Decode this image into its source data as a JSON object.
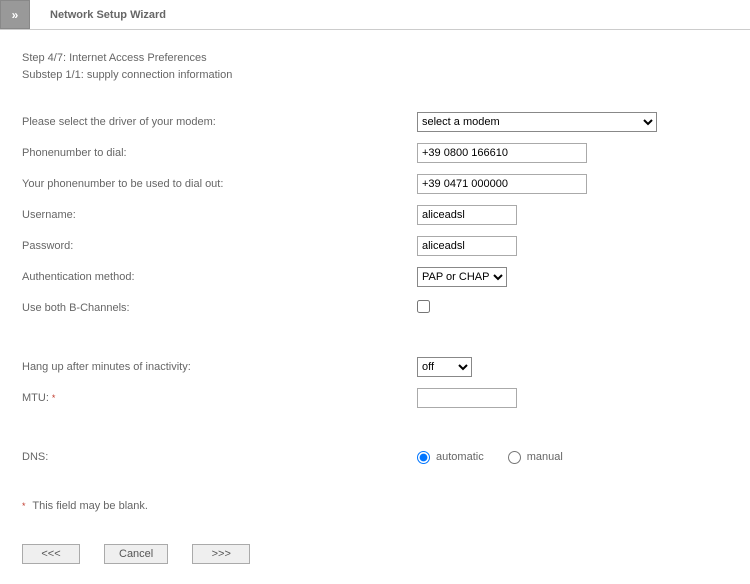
{
  "header": {
    "arrow": "»",
    "title": "Network Setup Wizard"
  },
  "step": {
    "line1": "Step 4/7: Internet Access Preferences",
    "line2": "Substep 1/1: supply connection information"
  },
  "fields": {
    "modem_label": "Please select the driver of your modem:",
    "modem_selected": "select a modem",
    "phone_dial_label": "Phonenumber to dial:",
    "phone_dial_value": "+39 0800 166610",
    "phone_out_label": "Your phonenumber to be used to dial out:",
    "phone_out_value": "+39 0471 000000",
    "username_label": "Username:",
    "username_value": "aliceadsl",
    "password_label": "Password:",
    "password_value": "aliceadsl",
    "auth_label": "Authentication method:",
    "auth_selected": "PAP or CHAP",
    "bchannels_label": "Use both B-Channels:",
    "hangup_label": "Hang up after minutes of inactivity:",
    "hangup_selected": "off",
    "mtu_label": "MTU:",
    "mtu_value": "",
    "dns_label": "DNS:",
    "dns_auto": "automatic",
    "dns_manual": "manual"
  },
  "marker": "*",
  "footnote": " This field may be blank.",
  "buttons": {
    "back": "<<<",
    "cancel": "Cancel",
    "next": ">>>"
  }
}
